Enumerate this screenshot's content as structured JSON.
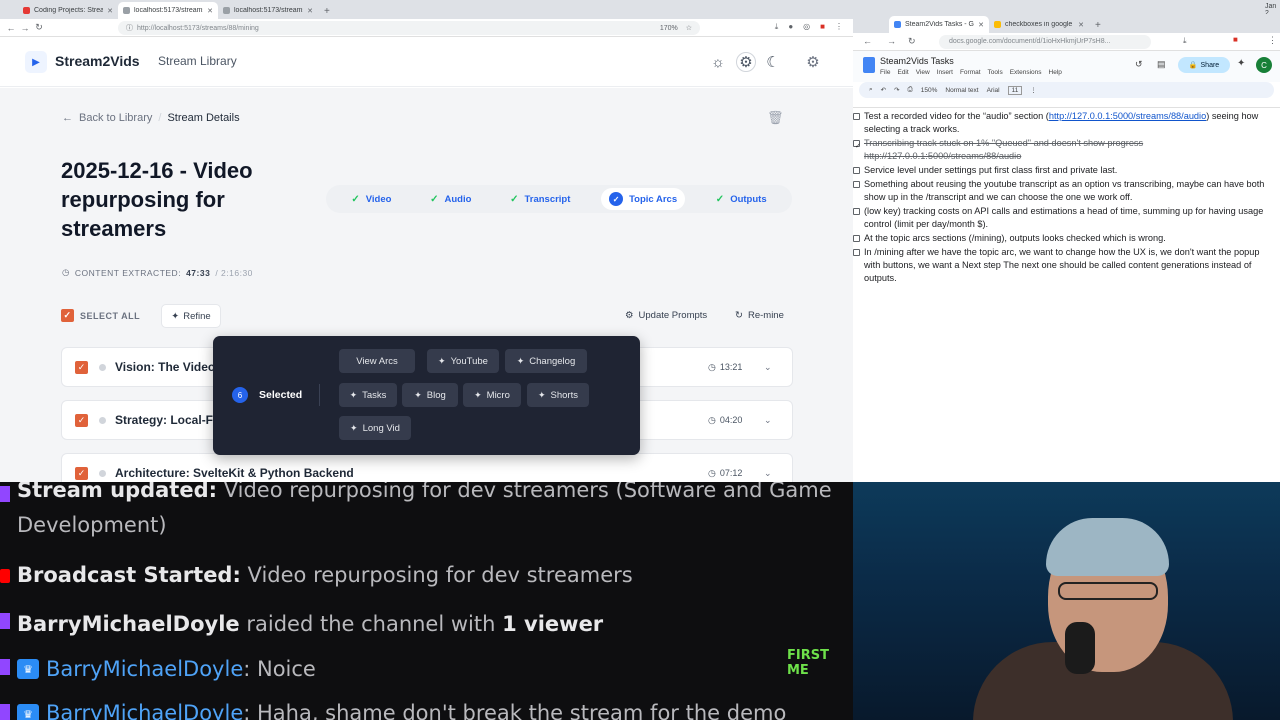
{
  "left_browser": {
    "tabs": [
      "Coding Projects: Stream...",
      "localhost:5173/streams/8...",
      "localhost:5173/streams/8..."
    ],
    "url": "http://localhost:5173/streams/88/mining",
    "zoom": "170%"
  },
  "app": {
    "brand": "Stream2Vids",
    "nav_library": "Stream Library",
    "breadcrumb_back": "Back to Library",
    "breadcrumb_current": "Stream Details",
    "title": "2025-12-16 - Video repurposing for streamers",
    "steps": [
      "Video",
      "Audio",
      "Transcript",
      "Topic Arcs",
      "Outputs"
    ],
    "extracted_label": "CONTENT EXTRACTED:",
    "extracted_value": "47:33",
    "extracted_total": "/ 2:16:30",
    "select_all": "SELECT ALL",
    "refine": "Refine",
    "update_prompts": "Update Prompts",
    "remine": "Re-mine",
    "arcs": [
      {
        "title": "Vision: The Video",
        "duration": "13:21"
      },
      {
        "title": "Strategy: Local-Fi",
        "duration": "04:20"
      },
      {
        "title": "Architecture: SvelteKit & Python Backend",
        "duration": "07:12"
      }
    ],
    "popup": {
      "count": "6",
      "selected": "Selected",
      "buttons": [
        "View Arcs",
        "YouTube",
        "Changelog",
        "Tasks",
        "Blog",
        "Micro",
        "Shorts",
        "Long Vid"
      ]
    }
  },
  "right_browser": {
    "tabs": [
      "Steam2Vids Tasks - Google...",
      "checkboxes in google doc..."
    ],
    "url": "docs.google.com/document/d/1ioHxHkmjUrP7sH8...",
    "clock": "Jan 2"
  },
  "doc": {
    "title": "Steam2Vids Tasks",
    "menu": [
      "File",
      "Edit",
      "View",
      "Insert",
      "Format",
      "Tools",
      "Extensions",
      "Help"
    ],
    "share": "Share",
    "avatar": "C",
    "toolbar": {
      "zoom": "150%",
      "style": "Normal text",
      "font": "Arial",
      "size": "11"
    },
    "items": [
      {
        "text": "Test a recorded video for the “audio” section (",
        "link": "http://127.0.0.1:5000/streams/88/audio",
        "after": ") seeing how selecting a track works.",
        "done": false
      },
      {
        "text": "Transcribing track stuck on 1% \"Queued\" and doesn't show progress ",
        "link": "http://127.0.0.1:5000/streams/88/audio",
        "after": "",
        "done": true
      },
      {
        "text": "Service level under settings put first class first and private last.",
        "done": false
      },
      {
        "text": "Something about reusing the youtube transcript as an option vs transcribing, maybe can have both show up in the /transcript and we can choose the one we work off.",
        "done": false
      },
      {
        "text": "(low key) tracking costs on API calls and estimations a head of time, summing up for having usage control (limit per day/month $).",
        "done": false
      },
      {
        "text": "At the topic arcs sections (/mining), outputs looks checked which is wrong.",
        "done": false
      },
      {
        "text": "In /mining after we have the topic arc, we want to change how the UX is, we don't want the popup with buttons, we want a Next step The next one should be called content generations instead of outputs.",
        "done": false
      }
    ]
  },
  "chat": {
    "l1_bold": "Stream updated:",
    "l1_text": " Video repurposing for dev streamers (Software and Game",
    "l1_cont": "Development)",
    "l2_bold": "Broadcast Started:",
    "l2_text": " Video repurposing for dev streamers",
    "l3_name": "BarryMichaelDoyle",
    "l3_text": " raided the channel with ",
    "l3_bold": "1 viewer",
    "l4_name": "BarryMichaelDoyle",
    "l4_text": ": Noice",
    "first_me": "FIRST ME",
    "l5_name": "BarryMichaelDoyle",
    "l5_text": ": Haha, shame don't break the stream for the demo"
  }
}
